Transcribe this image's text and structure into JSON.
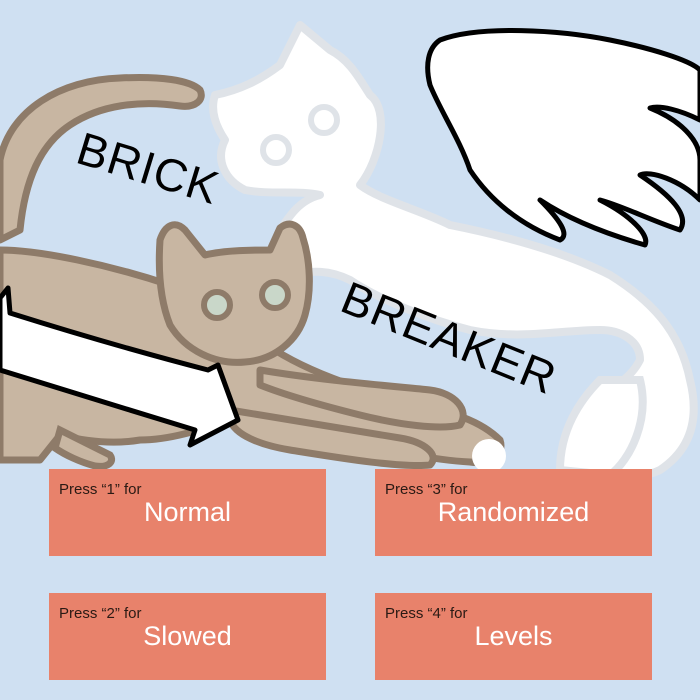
{
  "title": {
    "line1": "BRICK",
    "line2": "BREAKER"
  },
  "colors": {
    "background": "#cfe0f2",
    "button": "#e8826b",
    "brown_cat": "#c8b6a2",
    "brown_cat_outline": "#8e7b69",
    "white_cat": "#ffffff",
    "white_cat_outline": "#dfe3e8"
  },
  "modes": [
    {
      "key_hint": "Press “1” for",
      "label": "Normal"
    },
    {
      "key_hint": "Press “2” for",
      "label": "Slowed"
    },
    {
      "key_hint": "Press “3” for",
      "label": "Randomized"
    },
    {
      "key_hint": "Press “4” for",
      "label": "Levels"
    }
  ]
}
